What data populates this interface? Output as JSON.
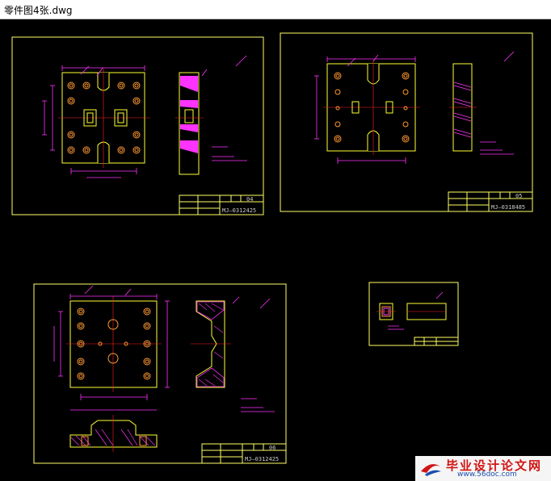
{
  "window": {
    "title": "零件图4张.dwg"
  },
  "sheets": [
    {
      "number": "04",
      "code": "MJ—0312425"
    },
    {
      "number": "05",
      "code": "MJ—0318485"
    },
    {
      "number": "06",
      "code": "MJ—0312425"
    }
  ],
  "watermark": {
    "text": "毕业设计论文网",
    "url": "www.56doc.com"
  },
  "colors": {
    "background": "#000000",
    "frame": "#ffff66",
    "dimension": "#ff33ff",
    "part": "#ffff33",
    "center": "#ff2222",
    "hole": "#ff9933",
    "title_text": "#cccccc",
    "watermark_red": "#d21414",
    "watermark_blue": "#1a4fb0"
  }
}
